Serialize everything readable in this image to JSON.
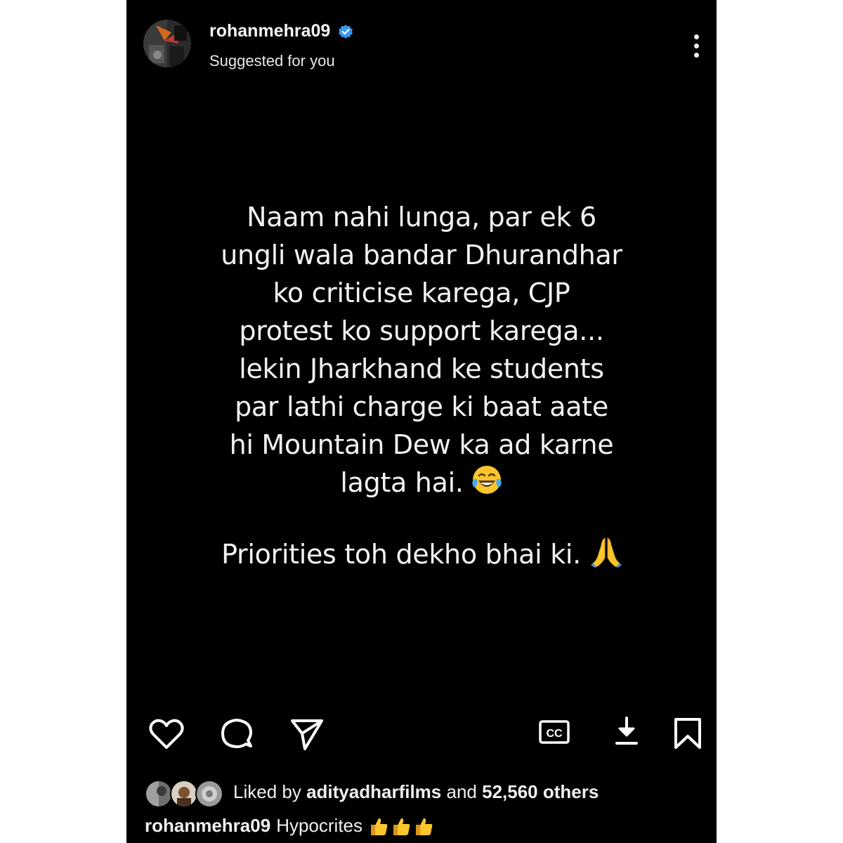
{
  "post": {
    "username": "rohanmehra09",
    "subtitle": "Suggested for you",
    "verified": true,
    "avatar_icon": "profile-photo",
    "quote_main": "Naam nahi lunga, par ek 6\nungli wala bandar Dhurandhar\nko criticise karega, CJP\nprotest ko support karega...\nlekin Jharkhand ke students\npar lathi charge ki baat aate\nhi Mountain Dew ka ad karne\nlagta hai.",
    "quote_main_emoji": "face-with-tears-of-joy",
    "quote_second": "Priorities toh dekho bhai ki.",
    "quote_second_emoji": "folded-hands"
  },
  "actions": {
    "like_icon": "heart-icon",
    "comment_icon": "comment-icon",
    "share_icon": "send-icon",
    "captions_icon": "cc-icon",
    "captions_label": "CC",
    "download_icon": "download-icon",
    "save_icon": "bookmark-icon"
  },
  "likes": {
    "prefix": "Liked by",
    "user": "adityadharfilms",
    "connector": "and",
    "count": "52,560 others"
  },
  "caption": {
    "username": "rohanmehra09",
    "text": "Hypocrites",
    "emoji": "thumbs-up x3"
  },
  "colors": {
    "background": "#000000",
    "text": "#f2f2f2",
    "verified_badge": "#3897f0",
    "emoji_yellow": "#fbc52d",
    "frame": "#ffffff"
  }
}
